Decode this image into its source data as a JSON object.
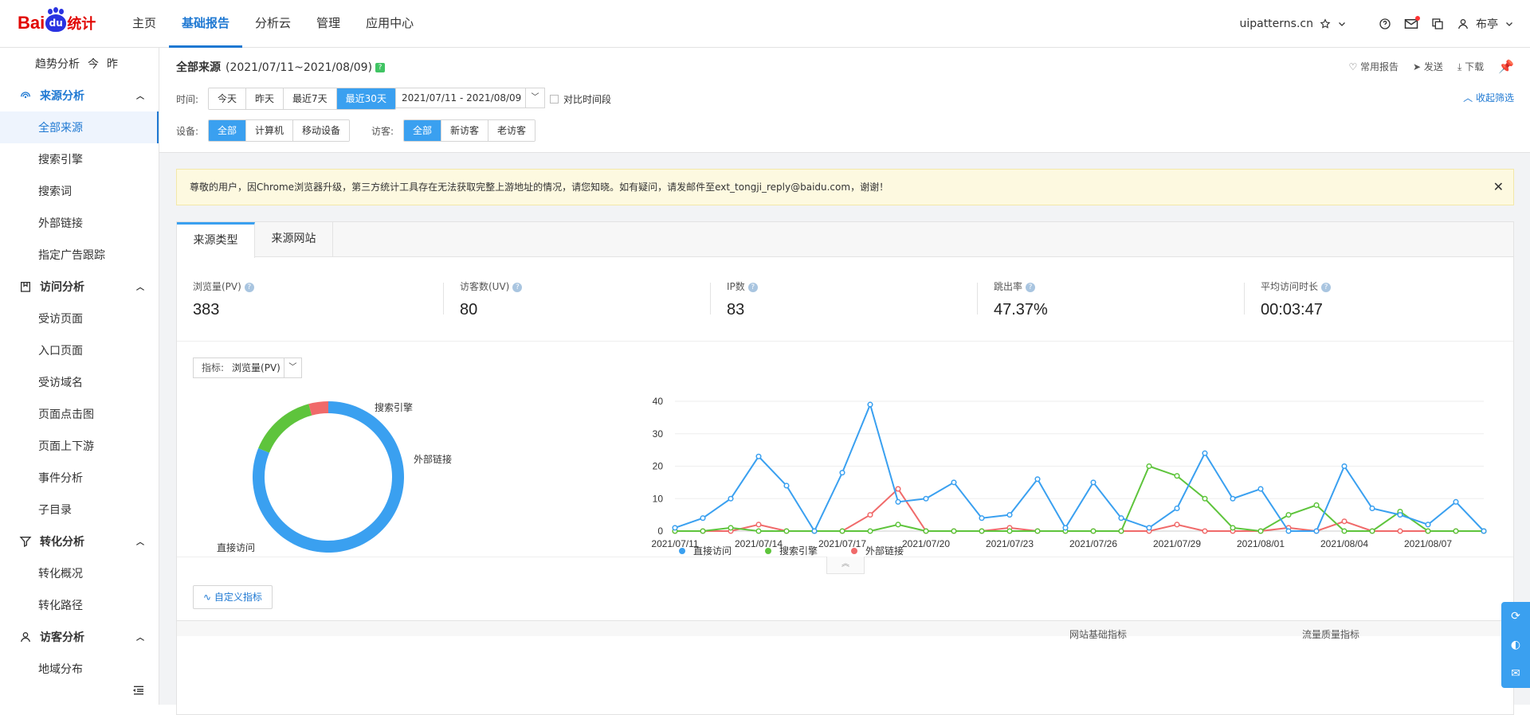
{
  "brand": {
    "logo_text_1": "Bai",
    "logo_paw": "du",
    "logo_text_2": "统计"
  },
  "nav": {
    "items": [
      "主页",
      "基础报告",
      "分析云",
      "管理",
      "应用中心"
    ],
    "active_index": 1
  },
  "header": {
    "site": "uipatterns.cn",
    "user": "布亭"
  },
  "sidebar": {
    "top": {
      "label": "趋势分析",
      "opt1": "今",
      "opt2": "昨"
    },
    "groups": [
      {
        "label": "来源分析",
        "items": [
          "全部来源",
          "搜索引擎",
          "搜索词",
          "外部链接",
          "指定广告跟踪"
        ]
      },
      {
        "label": "访问分析",
        "items": [
          "受访页面",
          "入口页面",
          "受访域名",
          "页面点击图",
          "页面上下游",
          "事件分析",
          "子目录"
        ]
      },
      {
        "label": "转化分析",
        "items": [
          "转化概况",
          "转化路径"
        ]
      },
      {
        "label": "访客分析",
        "items": [
          "地域分布"
        ]
      }
    ],
    "active_item": "全部来源"
  },
  "filter": {
    "title": "全部来源",
    "range_text": "(2021/07/11~2021/08/09)",
    "actions": [
      "常用报告",
      "发送",
      "下载"
    ],
    "time_label": "时间:",
    "time_buttons": [
      "今天",
      "昨天",
      "最近7天",
      "最近30天"
    ],
    "time_active": 3,
    "date_range": "2021/07/11 - 2021/08/09",
    "compare_label": "对比时间段",
    "collapse_label": "收起筛选",
    "device_label": "设备:",
    "device_buttons": [
      "全部",
      "计算机",
      "移动设备"
    ],
    "visitor_label": "访客:",
    "visitor_buttons": [
      "全部",
      "新访客",
      "老访客"
    ]
  },
  "notice": {
    "text": "尊敬的用户，因Chrome浏览器升级，第三方统计工具存在无法获取完整上游地址的情况，请您知晓。如有疑问，请发邮件至ext_tongji_reply@baidu.com，谢谢！"
  },
  "tabs": [
    "来源类型",
    "来源网站"
  ],
  "metrics": [
    {
      "label": "浏览量(PV)",
      "value": "383"
    },
    {
      "label": "访客数(UV)",
      "value": "80"
    },
    {
      "label": "IP数",
      "value": "83"
    },
    {
      "label": "跳出率",
      "value": "47.37%"
    },
    {
      "label": "平均访问时长",
      "value": "00:03:47"
    }
  ],
  "indicator": {
    "label": "指标:",
    "value": "浏览量(PV)"
  },
  "custom_button": "自定义指标",
  "table_head": [
    "网站基础指标",
    "流量质量指标"
  ],
  "colors": {
    "direct": "#3aa0f0",
    "search": "#5ec43c",
    "external": "#f06a6a",
    "accent": "#1e78d2"
  },
  "chart_data": [
    {
      "type": "pie",
      "labels": [
        "直接访问",
        "搜索引擎",
        "外部链接"
      ],
      "values": [
        311,
        56,
        16
      ],
      "colors": [
        "#3aa0f0",
        "#5ec43c",
        "#f06a6a"
      ]
    },
    {
      "type": "line",
      "x": [
        "2021/07/11",
        "2021/07/12",
        "2021/07/13",
        "2021/07/14",
        "2021/07/15",
        "2021/07/16",
        "2021/07/17",
        "2021/07/18",
        "2021/07/19",
        "2021/07/20",
        "2021/07/21",
        "2021/07/22",
        "2021/07/23",
        "2021/07/24",
        "2021/07/25",
        "2021/07/26",
        "2021/07/27",
        "2021/07/28",
        "2021/07/29",
        "2021/07/30",
        "2021/07/31",
        "2021/08/01",
        "2021/08/02",
        "2021/08/03",
        "2021/08/04",
        "2021/08/05",
        "2021/08/06",
        "2021/08/07",
        "2021/08/08",
        "2021/08/09"
      ],
      "tick_labels": [
        "2021/07/11",
        "2021/07/14",
        "2021/07/17",
        "2021/07/20",
        "2021/07/23",
        "2021/07/26",
        "2021/07/29",
        "2021/08/01",
        "2021/08/04",
        "2021/08/07"
      ],
      "ylim": [
        0,
        40
      ],
      "yticks": [
        0,
        10,
        20,
        30,
        40
      ],
      "series": [
        {
          "name": "直接访问",
          "color": "#3aa0f0",
          "values": [
            1,
            4,
            10,
            23,
            14,
            0,
            18,
            39,
            9,
            10,
            15,
            4,
            5,
            16,
            1,
            15,
            4,
            1,
            7,
            24,
            10,
            13,
            0,
            0,
            20,
            7,
            5,
            2,
            9,
            0
          ]
        },
        {
          "name": "搜索引擎",
          "color": "#5ec43c",
          "values": [
            0,
            0,
            1,
            0,
            0,
            0,
            0,
            0,
            2,
            0,
            0,
            0,
            0,
            0,
            0,
            0,
            0,
            20,
            17,
            10,
            1,
            0,
            5,
            8,
            0,
            0,
            6,
            0,
            0,
            0
          ]
        },
        {
          "name": "外部链接",
          "color": "#f06a6a",
          "values": [
            0,
            0,
            0,
            2,
            0,
            0,
            0,
            5,
            13,
            0,
            0,
            0,
            1,
            0,
            0,
            0,
            0,
            0,
            2,
            0,
            0,
            0,
            1,
            0,
            3,
            0,
            0,
            0,
            0,
            0
          ]
        }
      ]
    }
  ]
}
